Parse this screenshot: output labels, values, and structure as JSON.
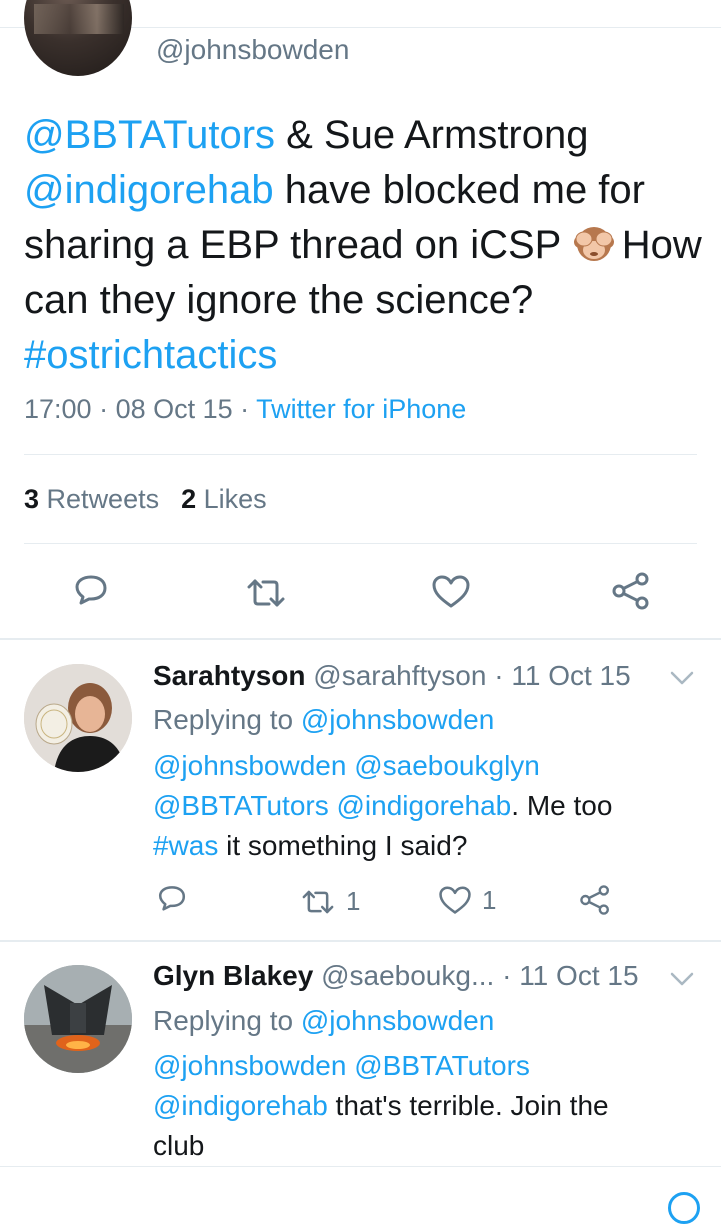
{
  "main_tweet": {
    "handle": "@johnsbowden",
    "text_parts": {
      "m1": "@BBTATutors",
      "t1": " & Sue Armstrong ",
      "m2": "@indigorehab",
      "t2": " have blocked me for sharing a EBP thread on iCSP ",
      "emoji": "see-no-evil-monkey",
      "t3": "How can they ignore the science? ",
      "hashtag": "#ostrichtactics"
    },
    "time": "17:00",
    "date": "08 Oct 15",
    "source": "Twitter for iPhone",
    "retweets_count": "3",
    "retweets_label": "Retweets",
    "likes_count": "2",
    "likes_label": "Likes"
  },
  "replies": [
    {
      "name": "Sarahtyson",
      "handle": "@sarahftyson",
      "date": "11 Oct 15",
      "replying_prefix": "Replying to ",
      "replying_to": "@johnsbowden",
      "mentions": "@johnsbowden @saeboukglyn @BBTATutors @indigorehab",
      "text_a": ". Me too ",
      "hashtag": "#was",
      "text_b": " it something I said?",
      "retweets": "1",
      "likes": "1"
    },
    {
      "name": "Glyn Blakey",
      "handle": "@saeboukg...",
      "date": "11 Oct 15",
      "replying_prefix": "Replying to ",
      "replying_to": "@johnsbowden",
      "mentions": "@johnsbowden @BBTATutors @indigorehab",
      "text_a": " that's terrible. Join the club"
    }
  ],
  "separator": " · ",
  "colors": {
    "link": "#1da1f2",
    "secondary": "#657786",
    "text": "#14171a",
    "divider": "#e6ecf0"
  },
  "icons": [
    "reply-icon",
    "retweet-icon",
    "like-icon",
    "share-icon",
    "chevron-down-icon"
  ]
}
